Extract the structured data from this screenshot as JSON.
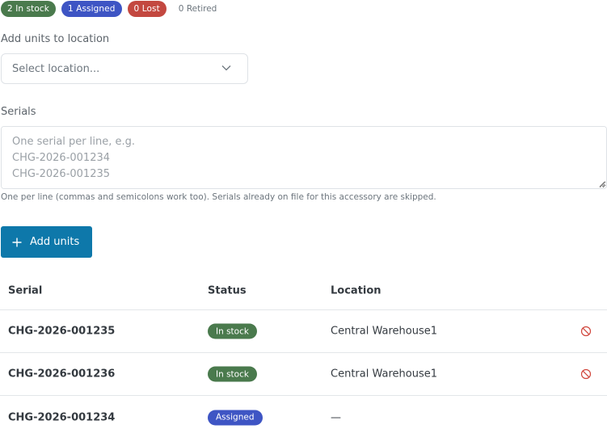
{
  "summary": {
    "in_stock": "2 In stock",
    "assigned": "1 Assigned",
    "lost": "0 Lost",
    "retired": "0 Retired"
  },
  "location": {
    "label": "Add units to location",
    "placeholder": "Select location..."
  },
  "serials": {
    "label": "Serials",
    "placeholder": "One serial per line, e.g.\nCHG-2026-001234\nCHG-2026-001235",
    "help": "One per line (commas and semicolons work too). Serials already on file for this accessory are skipped."
  },
  "add_button": {
    "label": "Add units",
    "icon": "plus-icon"
  },
  "table": {
    "headers": {
      "serial": "Serial",
      "status": "Status",
      "location": "Location"
    },
    "rows": [
      {
        "serial": "CHG-2026-001235",
        "status": "In stock",
        "location": "Central Warehouse1",
        "action_icon": "ban-icon"
      },
      {
        "serial": "CHG-2026-001236",
        "status": "In stock",
        "location": "Central Warehouse1",
        "action_icon": "ban-icon"
      },
      {
        "serial": "CHG-2026-001234",
        "status": "Assigned",
        "location": "—"
      }
    ]
  },
  "colors": {
    "in_stock": "#4a7a4d",
    "assigned": "#3e55c4",
    "lost": "#c34840",
    "primary": "#0e78aa",
    "danger_icon": "#d0443a"
  }
}
